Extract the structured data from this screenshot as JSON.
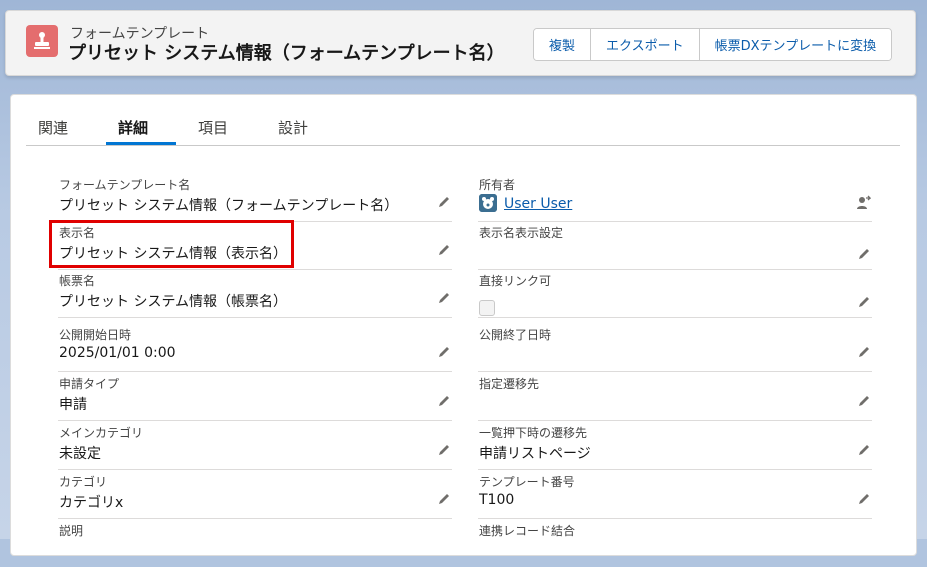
{
  "header": {
    "object_type": "フォームテンプレート",
    "record_title": "プリセット システム情報（フォームテンプレート名）",
    "icon": "stamp-icon",
    "icon_color": "#e46d6e",
    "buttons": [
      "複製",
      "エクスポート",
      "帳票DXテンプレートに変換"
    ]
  },
  "tabs": {
    "items": [
      "関連",
      "詳細",
      "項目",
      "設計"
    ],
    "active": "詳細",
    "accent_color": "#0176d3"
  },
  "fields": {
    "left": [
      {
        "label": "フォームテンプレート名",
        "value": "プリセット システム情報（フォームテンプレート名）"
      },
      {
        "label": "表示名",
        "value": "プリセット システム情報（表示名）"
      },
      {
        "label": "帳票名",
        "value": "プリセット システム情報（帳票名）"
      },
      {
        "label": "公開開始日時",
        "value": "2025/01/01 0:00"
      },
      {
        "label": "申請タイプ",
        "value": "申請"
      },
      {
        "label": "メインカテゴリ",
        "value": "未設定"
      },
      {
        "label": "カテゴリ",
        "value": "カテゴリx"
      },
      {
        "label": "説明",
        "value": ""
      }
    ],
    "right": [
      {
        "label": "所有者",
        "value": "User User"
      },
      {
        "label": "表示名表示設定",
        "value": ""
      },
      {
        "label": "直接リンク可",
        "value": ""
      },
      {
        "label": "公開終了日時",
        "value": ""
      },
      {
        "label": "指定遷移先",
        "value": ""
      },
      {
        "label": "一覧押下時の遷移先",
        "value": "申請リストページ"
      },
      {
        "label": "テンプレート番号",
        "value": "T100"
      },
      {
        "label": "連携レコード結合",
        "value": ""
      }
    ]
  },
  "highlight_color": "#e00000"
}
